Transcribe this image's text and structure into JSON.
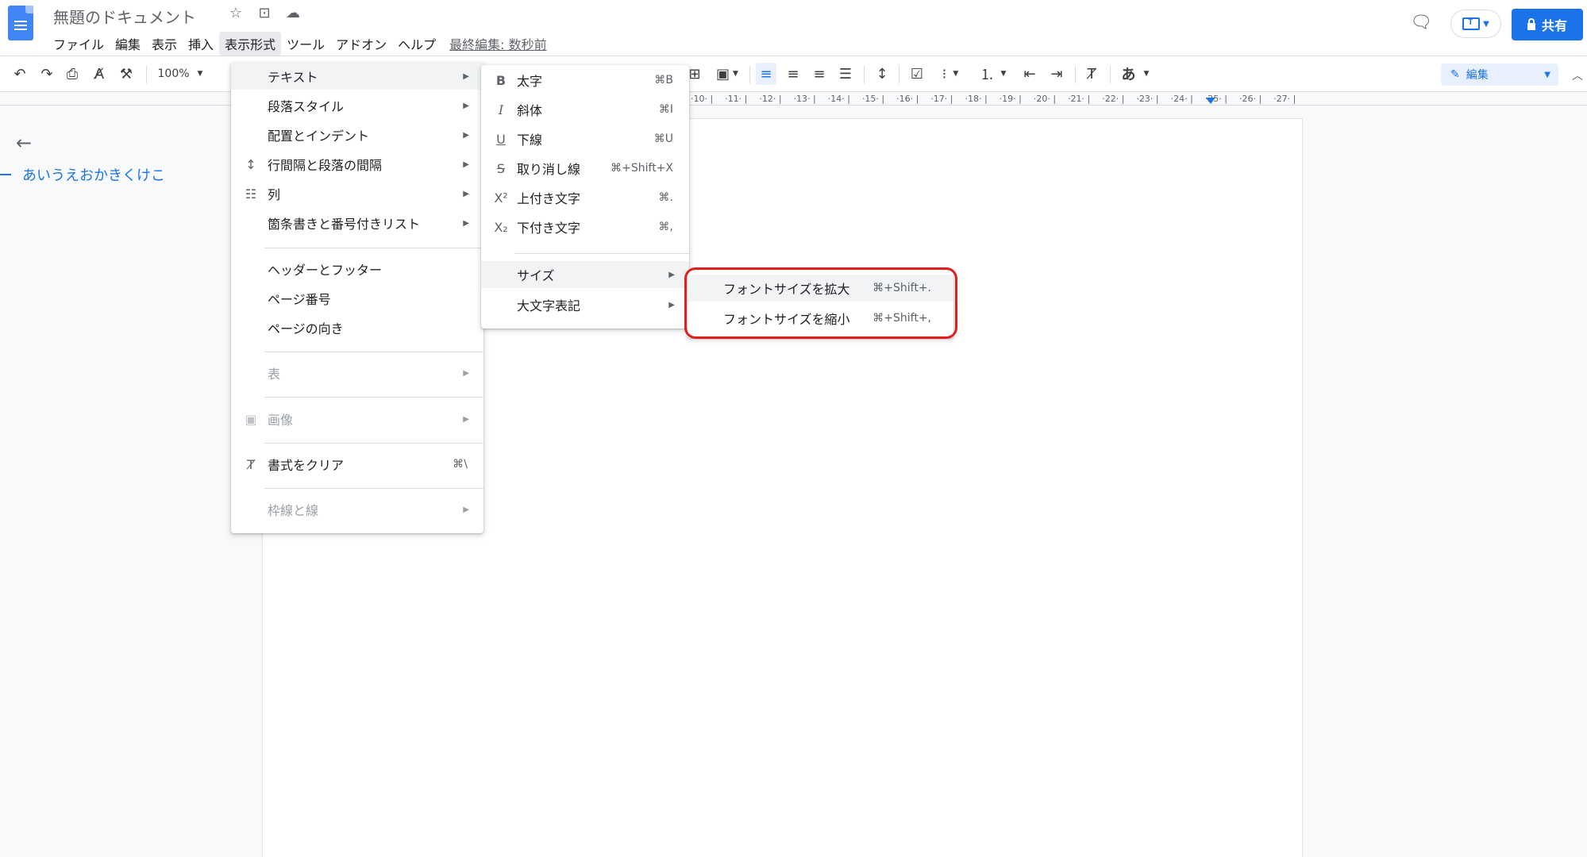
{
  "document": {
    "title": "無題のドキュメント",
    "last_edit": "最終編集: 数秒前"
  },
  "menubar": {
    "items": [
      "ファイル",
      "編集",
      "表示",
      "挿入",
      "表示形式",
      "ツール",
      "アドオン",
      "ヘルプ"
    ],
    "active_index": 4
  },
  "header": {
    "share_label": "共有"
  },
  "toolbar": {
    "zoom": "100%",
    "input_tool": "あ",
    "edit_mode_label": "編集"
  },
  "ruler": {
    "numbers": [
      "10",
      "11",
      "12",
      "13",
      "14",
      "15",
      "16",
      "17",
      "18",
      "19",
      "20",
      "21",
      "22",
      "23",
      "24",
      "25",
      "26",
      "27"
    ]
  },
  "outline": {
    "heading": "あいうえおかきくけこ"
  },
  "format_menu": {
    "items": [
      {
        "label": "テキスト",
        "submenu": true,
        "highlighted": true
      },
      {
        "label": "段落スタイル",
        "submenu": true
      },
      {
        "label": "配置とインデント",
        "submenu": true
      },
      {
        "label": "行間隔と段落の間隔",
        "submenu": true,
        "icon": "line-spacing-icon"
      },
      {
        "label": "列",
        "submenu": true,
        "icon": "columns-icon"
      },
      {
        "label": "箇条書きと番号付きリスト",
        "submenu": true
      },
      {
        "label": "ヘッダーとフッター"
      },
      {
        "label": "ページ番号"
      },
      {
        "label": "ページの向き"
      },
      {
        "label": "表",
        "submenu": true,
        "disabled": true
      },
      {
        "label": "画像",
        "submenu": true,
        "disabled": true,
        "icon": "image-icon"
      },
      {
        "label": "書式をクリア",
        "shortcut": "⌘\\",
        "icon": "clear-format-icon"
      },
      {
        "label": "枠線と線",
        "submenu": true,
        "disabled": true
      }
    ]
  },
  "text_menu": {
    "items": [
      {
        "label": "太字",
        "shortcut": "⌘B",
        "icon": "bold-icon"
      },
      {
        "label": "斜体",
        "shortcut": "⌘I",
        "icon": "italic-icon"
      },
      {
        "label": "下線",
        "shortcut": "⌘U",
        "icon": "underline-icon"
      },
      {
        "label": "取り消し線",
        "shortcut": "⌘+Shift+X",
        "icon": "strikethrough-icon"
      },
      {
        "label": "上付き文字",
        "shortcut": "⌘.",
        "icon": "superscript-icon"
      },
      {
        "label": "下付き文字",
        "shortcut": "⌘,",
        "icon": "subscript-icon"
      },
      {
        "label": "サイズ",
        "submenu": true,
        "highlighted": true
      },
      {
        "label": "大文字表記",
        "submenu": true
      }
    ]
  },
  "size_menu": {
    "items": [
      {
        "label": "フォントサイズを拡大",
        "shortcut": "⌘+Shift+.",
        "highlighted": true
      },
      {
        "label": "フォントサイズを縮小",
        "shortcut": "⌘+Shift+,"
      }
    ]
  },
  "colors": {
    "accent": "#1a73e8",
    "highlight_box": "#e01e1e"
  }
}
